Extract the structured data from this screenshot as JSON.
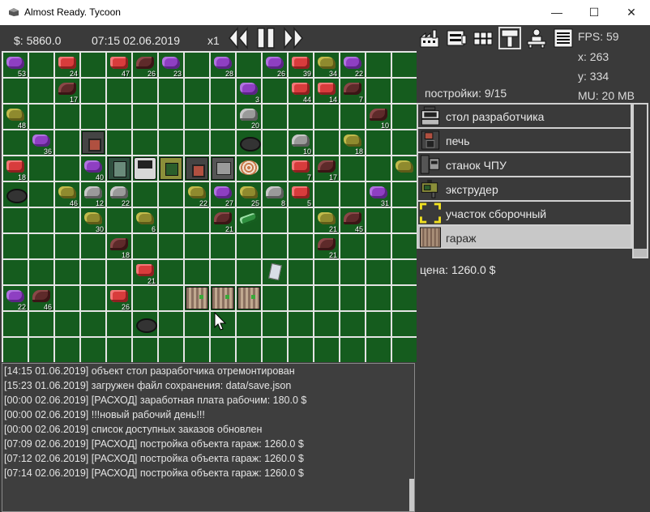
{
  "window": {
    "title": "Almost Ready. Tycoon",
    "minimize": "—",
    "maximize": "☐",
    "close": "✕"
  },
  "hud": {
    "money": "$: 5860.0",
    "datetime": "07:15 02.06.2019",
    "speed": "x1"
  },
  "toolbar": {
    "icons": [
      "factory-icon",
      "orders-icon",
      "resources-icon",
      "build-hammer-icon",
      "worker-icon",
      "menu-icon"
    ],
    "selected": "build-hammer-icon"
  },
  "stats": {
    "fps": "FPS: 59",
    "x": "x: 263",
    "y": "y: 334",
    "mu": "MU: 20 MB"
  },
  "build_panel": {
    "count_label": "постройки: 9/15",
    "items": [
      {
        "label": "стол разработчика",
        "icon": "developer-desk-icon"
      },
      {
        "label": "печь",
        "icon": "furnace-icon"
      },
      {
        "label": "станок ЧПУ",
        "icon": "cnc-machine-icon"
      },
      {
        "label": "экструдер",
        "icon": "extruder-icon"
      },
      {
        "label": "участок сборочный",
        "icon": "assembly-area-icon"
      },
      {
        "label": "гараж",
        "icon": "garage-icon"
      }
    ],
    "selected_index": 5,
    "price": "цена: 1260.0 $"
  },
  "map": {
    "resources": [
      {
        "c": 0,
        "r": 0,
        "t": "ore-purple",
        "n": "53"
      },
      {
        "c": 2,
        "r": 0,
        "t": "ore-red",
        "n": "24"
      },
      {
        "c": 4,
        "r": 0,
        "t": "ore-red",
        "n": "47"
      },
      {
        "c": 5,
        "r": 0,
        "t": "ore-dark",
        "n": "26"
      },
      {
        "c": 6,
        "r": 0,
        "t": "ore-purple",
        "n": "23"
      },
      {
        "c": 8,
        "r": 0,
        "t": "ore-purple",
        "n": "28"
      },
      {
        "c": 10,
        "r": 0,
        "t": "ore-purple",
        "n": "26"
      },
      {
        "c": 11,
        "r": 0,
        "t": "ore-red",
        "n": "39"
      },
      {
        "c": 12,
        "r": 0,
        "t": "ore-gold",
        "n": "34"
      },
      {
        "c": 13,
        "r": 0,
        "t": "ore-purple",
        "n": "22"
      },
      {
        "c": 2,
        "r": 1,
        "t": "ore-dark",
        "n": "17"
      },
      {
        "c": 9,
        "r": 1,
        "t": "ore-purple",
        "n": "3"
      },
      {
        "c": 11,
        "r": 1,
        "t": "ore-red",
        "n": "44"
      },
      {
        "c": 12,
        "r": 1,
        "t": "ore-red",
        "n": "14"
      },
      {
        "c": 13,
        "r": 1,
        "t": "ore-dark",
        "n": "7"
      },
      {
        "c": 0,
        "r": 2,
        "t": "ore-gold",
        "n": "48"
      },
      {
        "c": 9,
        "r": 2,
        "t": "ore-grey",
        "n": "20"
      },
      {
        "c": 14,
        "r": 2,
        "t": "ore-dark",
        "n": "10"
      },
      {
        "c": 1,
        "r": 3,
        "t": "ore-purple",
        "n": "36"
      },
      {
        "c": 11,
        "r": 3,
        "t": "ore-grey",
        "n": "10"
      },
      {
        "c": 13,
        "r": 3,
        "t": "ore-gold",
        "n": "18"
      },
      {
        "c": 0,
        "r": 4,
        "t": "ore-red",
        "n": "18"
      },
      {
        "c": 3,
        "r": 4,
        "t": "ore-purple",
        "n": "40"
      },
      {
        "c": 11,
        "r": 4,
        "t": "ore-red",
        "n": "7"
      },
      {
        "c": 12,
        "r": 4,
        "t": "ore-dark",
        "n": "17"
      },
      {
        "c": 15,
        "r": 4,
        "t": "ore-gold",
        "n": ""
      },
      {
        "c": 2,
        "r": 5,
        "t": "ore-gold",
        "n": "46"
      },
      {
        "c": 3,
        "r": 5,
        "t": "ore-grey",
        "n": "12"
      },
      {
        "c": 4,
        "r": 5,
        "t": "ore-grey",
        "n": "22"
      },
      {
        "c": 7,
        "r": 5,
        "t": "ore-gold",
        "n": "22"
      },
      {
        "c": 8,
        "r": 5,
        "t": "ore-purple",
        "n": "27"
      },
      {
        "c": 9,
        "r": 5,
        "t": "ore-gold",
        "n": "25"
      },
      {
        "c": 10,
        "r": 5,
        "t": "ore-grey",
        "n": "8"
      },
      {
        "c": 11,
        "r": 5,
        "t": "ore-red",
        "n": "5"
      },
      {
        "c": 14,
        "r": 5,
        "t": "ore-purple",
        "n": "31"
      },
      {
        "c": 3,
        "r": 6,
        "t": "ore-gold",
        "n": "30"
      },
      {
        "c": 5,
        "r": 6,
        "t": "ore-gold",
        "n": "6"
      },
      {
        "c": 8,
        "r": 6,
        "t": "ore-dark",
        "n": "21"
      },
      {
        "c": 9,
        "r": 6,
        "t": "ore-gem",
        "n": ""
      },
      {
        "c": 12,
        "r": 6,
        "t": "ore-gold",
        "n": "21"
      },
      {
        "c": 13,
        "r": 6,
        "t": "ore-dark",
        "n": "45"
      },
      {
        "c": 4,
        "r": 7,
        "t": "ore-dark",
        "n": "18"
      },
      {
        "c": 12,
        "r": 7,
        "t": "ore-dark",
        "n": "21"
      },
      {
        "c": 5,
        "r": 8,
        "t": "ore-red",
        "n": "21"
      },
      {
        "c": 0,
        "r": 9,
        "t": "ore-purple",
        "n": "22"
      },
      {
        "c": 1,
        "r": 9,
        "t": "ore-dark",
        "n": "46"
      },
      {
        "c": 4,
        "r": 9,
        "t": "ore-red",
        "n": "26"
      }
    ],
    "buildings": [
      {
        "c": 3,
        "r": 3,
        "t": "furnace"
      },
      {
        "c": 9,
        "r": 3,
        "t": "pot"
      },
      {
        "c": 4,
        "r": 4,
        "t": "machine"
      },
      {
        "c": 5,
        "r": 4,
        "t": "desk"
      },
      {
        "c": 6,
        "r": 4,
        "t": "extruder"
      },
      {
        "c": 7,
        "r": 4,
        "t": "furnace"
      },
      {
        "c": 8,
        "r": 4,
        "t": "cnc"
      },
      {
        "c": 9,
        "r": 4,
        "t": "coil"
      },
      {
        "c": 0,
        "r": 5,
        "t": "pot"
      },
      {
        "c": 10,
        "r": 8,
        "t": "paper"
      },
      {
        "c": 7,
        "r": 9,
        "t": "garage"
      },
      {
        "c": 8,
        "r": 9,
        "t": "garage"
      },
      {
        "c": 9,
        "r": 9,
        "t": "garage"
      },
      {
        "c": 5,
        "r": 10,
        "t": "pot"
      }
    ],
    "invalid_placement": {
      "c": 8,
      "r": 9
    }
  },
  "log": [
    "[14:15 01.06.2019] объект стол разработчика отремонтирован",
    "[15:23 01.06.2019] загружен файл сохранения: data/save.json",
    "[00:00 02.06.2019] [РАСХОД] заработная плата рабочим: 180.0 $",
    "[00:00 02.06.2019] !!!новый рабочий день!!!",
    "[00:00 02.06.2019] список доступных заказов обновлен",
    "[07:09 02.06.2019] [РАСХОД] постройка объекта гараж: 1260.0 $",
    "[07:12 02.06.2019] [РАСХОД] постройка объекта гараж: 1260.0 $",
    "[07:14 02.06.2019] [РАСХОД] постройка объекта гараж: 1260.0 $"
  ]
}
